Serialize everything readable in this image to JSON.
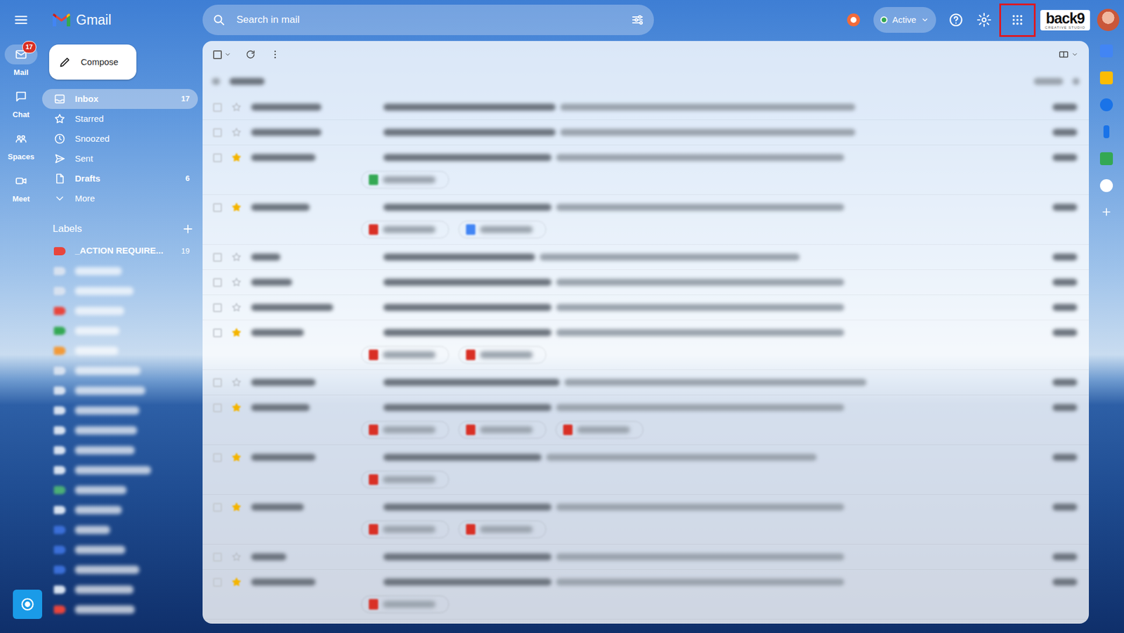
{
  "app": {
    "name": "Gmail"
  },
  "search": {
    "placeholder": "Search in mail"
  },
  "status": {
    "label": "Active"
  },
  "brand": {
    "name": "back9",
    "tagline": "CREATIVE STUDIO"
  },
  "rail": [
    {
      "label": "Mail",
      "badge": "17",
      "selected": true
    },
    {
      "label": "Chat",
      "badge": "",
      "selected": false
    },
    {
      "label": "Spaces",
      "badge": "",
      "selected": false
    },
    {
      "label": "Meet",
      "badge": "",
      "selected": false
    }
  ],
  "compose": "Compose",
  "folders": [
    {
      "label": "Inbox",
      "count": "17",
      "selected": true,
      "bold": true
    },
    {
      "label": "Starred",
      "count": "",
      "selected": false,
      "bold": false
    },
    {
      "label": "Snoozed",
      "count": "",
      "selected": false,
      "bold": false
    },
    {
      "label": "Sent",
      "count": "",
      "selected": false,
      "bold": false
    },
    {
      "label": "Drafts",
      "count": "6",
      "selected": false,
      "bold": true
    },
    {
      "label": "More",
      "count": "",
      "selected": false,
      "bold": false
    }
  ],
  "labels": {
    "title": "Labels",
    "items": [
      {
        "label": "_ACTION REQUIRE...",
        "count": "19",
        "color": "#e8453c",
        "blurred": false
      },
      {
        "color": "#d8e2f0",
        "blurred": true
      },
      {
        "color": "#d8e2f0",
        "blurred": true
      },
      {
        "color": "#e8453c",
        "blurred": true
      },
      {
        "color": "#34a853",
        "blurred": true
      },
      {
        "color": "#f29a38",
        "blurred": true
      },
      {
        "color": "#d8e2f0",
        "blurred": true
      },
      {
        "color": "#d8e2f0",
        "blurred": true
      },
      {
        "color": "#d8e2f0",
        "blurred": true
      },
      {
        "color": "#d8e2f0",
        "blurred": true
      },
      {
        "color": "#d8e2f0",
        "blurred": true
      },
      {
        "color": "#d8e2f0",
        "blurred": true
      },
      {
        "color": "#4caf76",
        "blurred": true
      },
      {
        "color": "#d8e2f0",
        "blurred": true
      },
      {
        "color": "#3b6fd8",
        "blurred": true
      },
      {
        "color": "#3b6fd8",
        "blurred": true
      },
      {
        "color": "#3b6fd8",
        "blurred": true
      },
      {
        "color": "#d8e2f0",
        "blurred": true
      },
      {
        "color": "#e8453c",
        "blurred": true
      }
    ]
  },
  "rows": [
    {
      "starred": false,
      "chips": []
    },
    {
      "starred": false,
      "chips": []
    },
    {
      "starred": true,
      "chips": [
        {
          "color": "#34a853"
        }
      ]
    },
    {
      "starred": true,
      "chips": [
        {
          "color": "#d93025"
        },
        {
          "color": "#4285f4"
        }
      ]
    },
    {
      "starred": false,
      "chips": []
    },
    {
      "starred": false,
      "chips": []
    },
    {
      "starred": false,
      "chips": []
    },
    {
      "starred": true,
      "chips": [
        {
          "color": "#d93025"
        },
        {
          "color": "#d93025"
        }
      ]
    },
    {
      "starred": false,
      "chips": []
    },
    {
      "starred": true,
      "chips": [
        {
          "color": "#d93025"
        },
        {
          "color": "#d93025"
        },
        {
          "color": "#d93025"
        }
      ]
    },
    {
      "starred": true,
      "chips": [
        {
          "color": "#d93025"
        }
      ]
    },
    {
      "starred": true,
      "chips": [
        {
          "color": "#d93025"
        },
        {
          "color": "#d93025"
        }
      ]
    },
    {
      "starred": false,
      "chips": []
    },
    {
      "starred": true,
      "chips": [
        {
          "color": "#d93025"
        }
      ]
    }
  ]
}
